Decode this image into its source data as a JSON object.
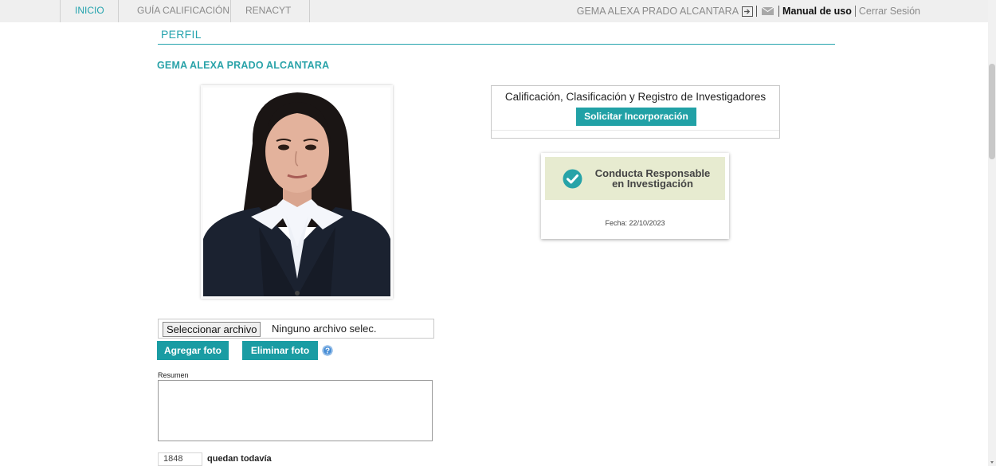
{
  "nav": {
    "tabs": [
      {
        "label": "INICIO",
        "active": true
      },
      {
        "label": "GUÍA CALIFICACIÓN",
        "active": false
      },
      {
        "label": "RENACYT",
        "active": false
      }
    ],
    "user_name": "GEMA ALEXA PRADO ALCANTARA",
    "manual_label": "Manual de uso",
    "logout_label": "Cerrar Sesión",
    "icons": [
      "logout-icon",
      "mail-icon"
    ]
  },
  "profile": {
    "section_title": "PERFIL",
    "name": "GEMA ALEXA PRADO ALCANTARA",
    "photo_alt": "profile-photo"
  },
  "calificacion": {
    "title": "Calificación, Clasificación y Registro de Investigadores",
    "button_label": "Solicitar Incorporación"
  },
  "badge": {
    "line1": "Conducta Responsable",
    "line2": "en Investigación",
    "date": "Fecha: 22/10/2023",
    "icon": "check-circle-icon"
  },
  "upload": {
    "choose_label": "Seleccionar archivo",
    "status": "Ninguno archivo selec.",
    "add_label": "Agregar foto",
    "delete_label": "Eliminar foto",
    "help_icon": "help-icon"
  },
  "resumen": {
    "label": "Resumen",
    "value": "",
    "remaining": "1848",
    "remaining_label": "quedan todavía"
  },
  "colors": {
    "accent": "#24a3ad",
    "button": "#1a9ca3",
    "badge_bg": "#e7ebd0",
    "check": "#27a3a8"
  }
}
